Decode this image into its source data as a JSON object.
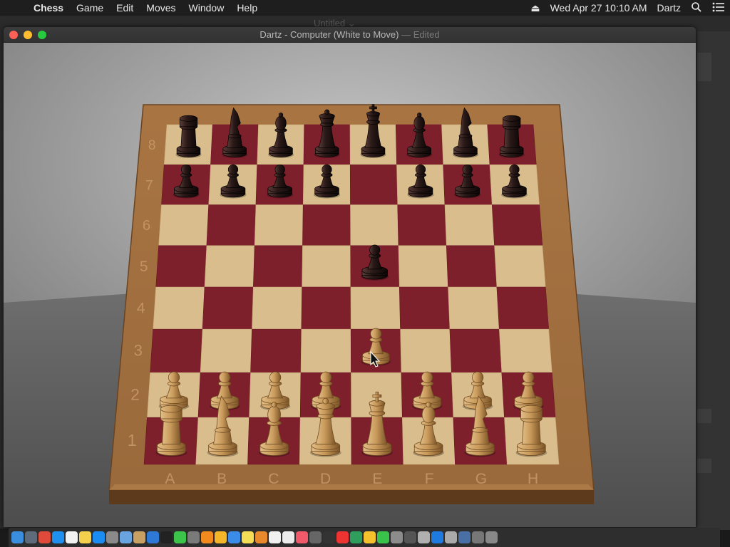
{
  "menubar": {
    "apple": "",
    "app": "Chess",
    "menus": [
      "Game",
      "Edit",
      "Moves",
      "Window",
      "Help"
    ],
    "eject": "⏏",
    "datetime": "Wed Apr 27  10:10 AM",
    "user": "Dartz"
  },
  "background_window": {
    "title": "Untitled ⌄"
  },
  "window": {
    "title": "Dartz - Computer   (White to Move)",
    "title_suffix": " — Edited"
  },
  "board": {
    "files": [
      "A",
      "B",
      "C",
      "D",
      "E",
      "F",
      "G",
      "H"
    ],
    "ranks": [
      "8",
      "7",
      "6",
      "5",
      "4",
      "3",
      "2",
      "1"
    ],
    "side_to_move": "White",
    "pieces": [
      {
        "sq": "a8",
        "piece": "rook",
        "color": "black"
      },
      {
        "sq": "b8",
        "piece": "knight",
        "color": "black"
      },
      {
        "sq": "c8",
        "piece": "bishop",
        "color": "black"
      },
      {
        "sq": "d8",
        "piece": "queen",
        "color": "black"
      },
      {
        "sq": "e8",
        "piece": "king",
        "color": "black"
      },
      {
        "sq": "f8",
        "piece": "bishop",
        "color": "black"
      },
      {
        "sq": "g8",
        "piece": "knight",
        "color": "black"
      },
      {
        "sq": "h8",
        "piece": "rook",
        "color": "black"
      },
      {
        "sq": "a7",
        "piece": "pawn",
        "color": "black"
      },
      {
        "sq": "b7",
        "piece": "pawn",
        "color": "black"
      },
      {
        "sq": "c7",
        "piece": "pawn",
        "color": "black"
      },
      {
        "sq": "d7",
        "piece": "pawn",
        "color": "black"
      },
      {
        "sq": "f7",
        "piece": "pawn",
        "color": "black"
      },
      {
        "sq": "g7",
        "piece": "pawn",
        "color": "black"
      },
      {
        "sq": "h7",
        "piece": "pawn",
        "color": "black"
      },
      {
        "sq": "e5",
        "piece": "pawn",
        "color": "black"
      },
      {
        "sq": "e3",
        "piece": "pawn",
        "color": "white"
      },
      {
        "sq": "a2",
        "piece": "pawn",
        "color": "white"
      },
      {
        "sq": "b2",
        "piece": "pawn",
        "color": "white"
      },
      {
        "sq": "c2",
        "piece": "pawn",
        "color": "white"
      },
      {
        "sq": "d2",
        "piece": "pawn",
        "color": "white"
      },
      {
        "sq": "f2",
        "piece": "pawn",
        "color": "white"
      },
      {
        "sq": "g2",
        "piece": "pawn",
        "color": "white"
      },
      {
        "sq": "h2",
        "piece": "pawn",
        "color": "white"
      },
      {
        "sq": "a1",
        "piece": "rook",
        "color": "white"
      },
      {
        "sq": "b1",
        "piece": "knight",
        "color": "white"
      },
      {
        "sq": "c1",
        "piece": "bishop",
        "color": "white"
      },
      {
        "sq": "d1",
        "piece": "queen",
        "color": "white"
      },
      {
        "sq": "e1",
        "piece": "king",
        "color": "white"
      },
      {
        "sq": "f1",
        "piece": "bishop",
        "color": "white"
      },
      {
        "sq": "g1",
        "piece": "knight",
        "color": "white"
      },
      {
        "sq": "h1",
        "piece": "rook",
        "color": "white"
      }
    ]
  },
  "colors": {
    "light_square": "#d9bd8c",
    "dark_square": "#7e1f2c",
    "frame": "#9a6a3c",
    "white_piece": "#c99a5b",
    "black_piece": "#2a1a18"
  },
  "dock": {
    "apps": [
      "finder-icon",
      "launchpad-icon",
      "chrome-icon",
      "safari-icon",
      "calendar-icon",
      "notes-icon",
      "app-store-icon",
      "preferences-icon",
      "preview-icon",
      "files-icon",
      "xcode-icon",
      "terminal-icon",
      "facetime-icon",
      "documents-icon",
      "vlc-icon",
      "sketch-icon",
      "mail-icon",
      "stickies-icon",
      "books-icon",
      "photos-icon",
      "textedit-icon",
      "music-icon",
      "utility-icon",
      "activity-icon",
      "news-icon",
      "maps-icon",
      "chrome-canary-icon",
      "messages-icon",
      "chess-icon",
      "script-icon",
      "audio-icon",
      "store-icon",
      "downloads-icon",
      "folder-icon",
      "stacks-icon",
      "trash-icon"
    ]
  }
}
